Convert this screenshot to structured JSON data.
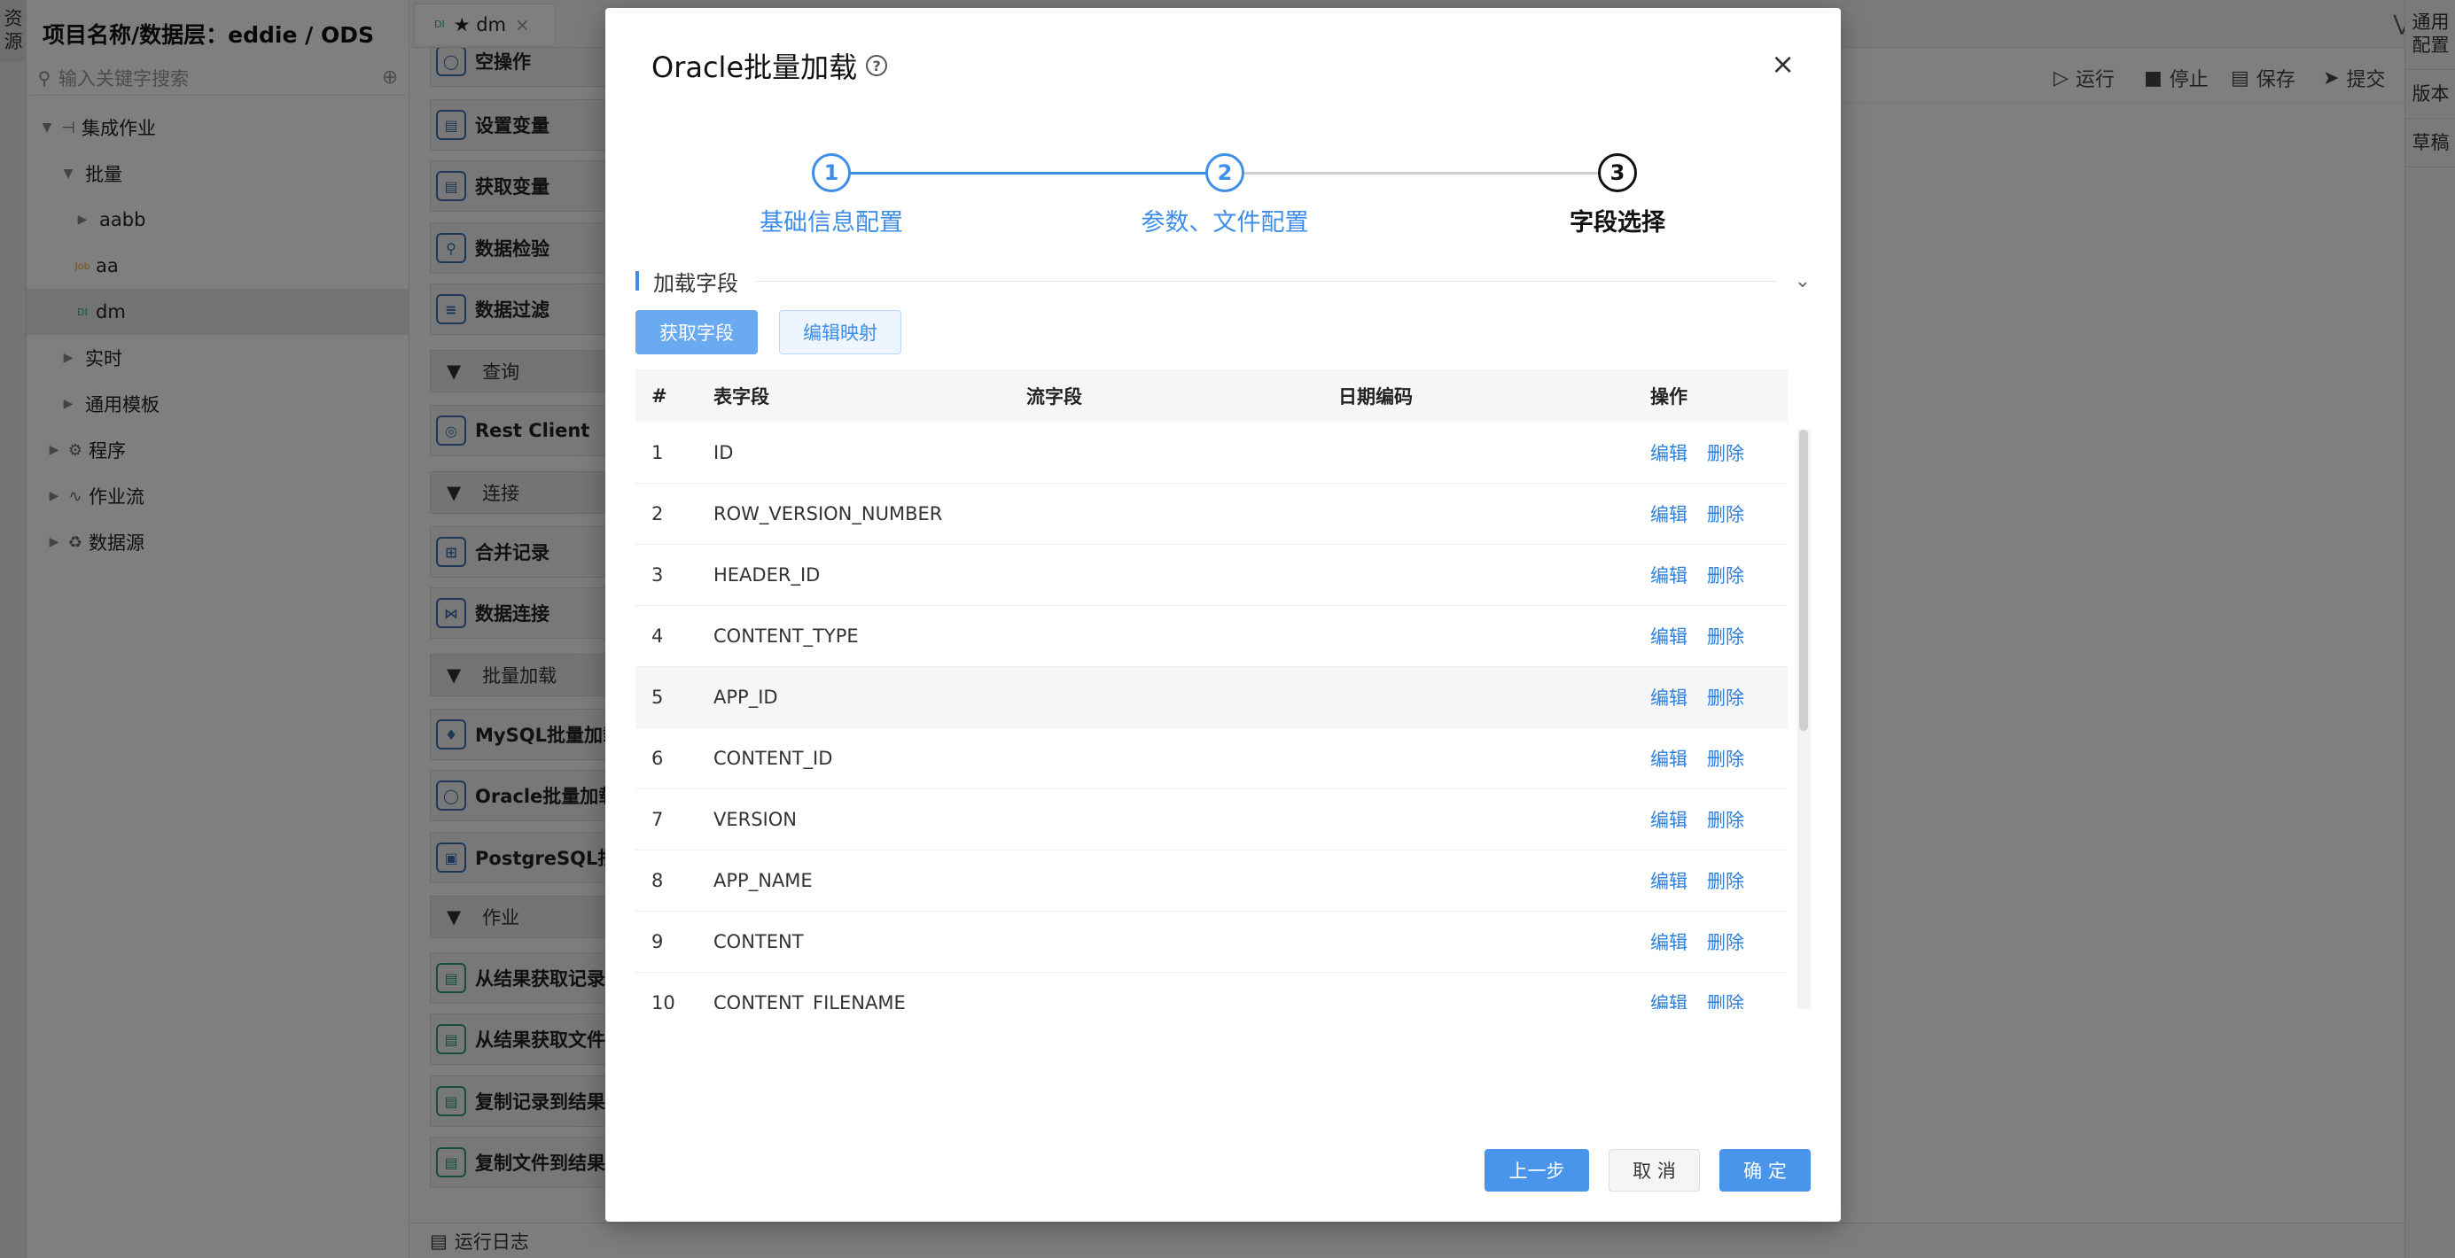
{
  "left_rail": {
    "label": "资源"
  },
  "tree": {
    "title": "项目名称/数据层：eddie / ODS",
    "search_placeholder": "输入关键字搜索",
    "nodes": [
      {
        "label": "集成作业",
        "badge": ""
      },
      {
        "label": "批量",
        "badge": ""
      },
      {
        "label": "aabb",
        "badge": ""
      },
      {
        "label": "aa",
        "badge": "Job"
      },
      {
        "label": "dm",
        "badge": "DI"
      },
      {
        "label": "实时",
        "badge": ""
      },
      {
        "label": "通用模板",
        "badge": ""
      },
      {
        "label": "程序",
        "badge": ""
      },
      {
        "label": "作业流",
        "badge": ""
      },
      {
        "label": "数据源",
        "badge": ""
      }
    ]
  },
  "editor_tab": {
    "badge": "DI",
    "label": "★ dm",
    "close": "×"
  },
  "palette": {
    "items": [
      {
        "label": "空操作"
      },
      {
        "label": "设置变量"
      },
      {
        "label": "获取变量"
      },
      {
        "label": "数据检验"
      },
      {
        "label": "数据过滤"
      },
      {
        "label": "Rest Client"
      },
      {
        "label": "合并记录"
      },
      {
        "label": "数据连接"
      },
      {
        "label": "MySQL批量加载"
      },
      {
        "label": "Oracle批量加载"
      },
      {
        "label": "PostgreSQL批量加载"
      },
      {
        "label": "从结果获取记录"
      },
      {
        "label": "从结果获取文件"
      },
      {
        "label": "复制记录到结果"
      },
      {
        "label": "复制文件到结果"
      }
    ],
    "categories": [
      {
        "label": "查询"
      },
      {
        "label": "连接"
      },
      {
        "label": "批量加载"
      },
      {
        "label": "作业"
      }
    ]
  },
  "toolbar": {
    "run": "运行",
    "stop": "停止",
    "save": "保存",
    "submit": "提交"
  },
  "right_rail": {
    "items": [
      "通用配置",
      "版本",
      "草稿"
    ]
  },
  "bottom_bar": {
    "label": "运行日志"
  },
  "modal": {
    "title": "Oracle批量加载",
    "help": "?",
    "close": "×",
    "steps": [
      {
        "num": "1",
        "label": "基础信息配置"
      },
      {
        "num": "2",
        "label": "参数、文件配置"
      },
      {
        "num": "3",
        "label": "字段选择"
      }
    ],
    "active_step": 3,
    "section_title": "加载字段",
    "btn_fetch": "获取字段",
    "btn_mapping": "编辑映射",
    "table": {
      "columns": [
        "#",
        "表字段",
        "流字段",
        "日期编码",
        "操作"
      ],
      "rows": [
        {
          "idx": "1",
          "table_field": "ID",
          "stream_field": "",
          "date_code": ""
        },
        {
          "idx": "2",
          "table_field": "ROW_VERSION_NUMBER",
          "stream_field": "",
          "date_code": ""
        },
        {
          "idx": "3",
          "table_field": "HEADER_ID",
          "stream_field": "",
          "date_code": ""
        },
        {
          "idx": "4",
          "table_field": "CONTENT_TYPE",
          "stream_field": "",
          "date_code": ""
        },
        {
          "idx": "5",
          "table_field": "APP_ID",
          "stream_field": "",
          "date_code": ""
        },
        {
          "idx": "6",
          "table_field": "CONTENT_ID",
          "stream_field": "",
          "date_code": ""
        },
        {
          "idx": "7",
          "table_field": "VERSION",
          "stream_field": "",
          "date_code": ""
        },
        {
          "idx": "8",
          "table_field": "APP_NAME",
          "stream_field": "",
          "date_code": ""
        },
        {
          "idx": "9",
          "table_field": "CONTENT",
          "stream_field": "",
          "date_code": ""
        },
        {
          "idx": "10",
          "table_field": "CONTENT_FILENAME",
          "stream_field": "",
          "date_code": ""
        }
      ],
      "edit_label": "编辑",
      "delete_label": "删除"
    },
    "footer": {
      "prev": "上一步",
      "cancel": "取 消",
      "ok": "确 定"
    }
  },
  "colors": {
    "accent": "#3e8ee8",
    "link": "#2f7fd9",
    "overlay": "rgba(0,0,0,0.5)"
  }
}
